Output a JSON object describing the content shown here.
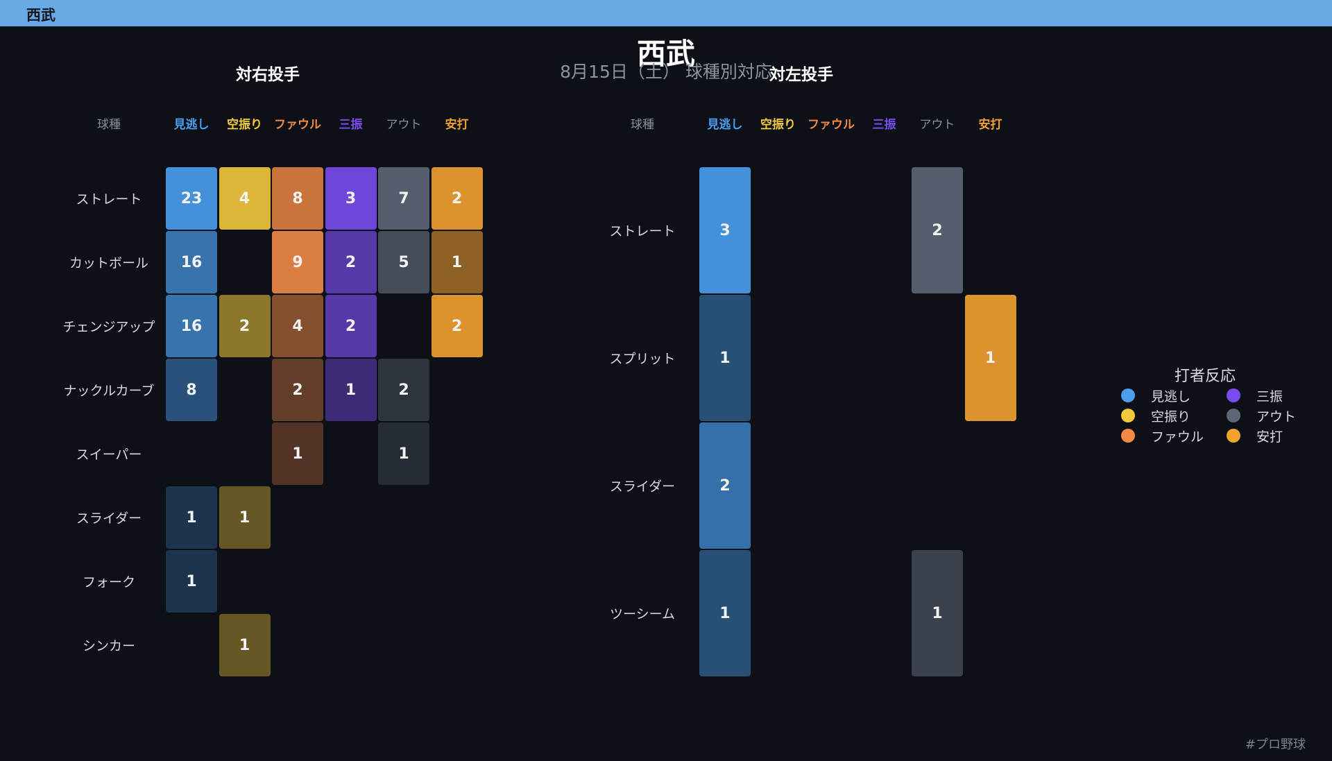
{
  "header": {
    "title": "西武"
  },
  "title": "西武",
  "subtitle": "8月15日（土） 球種別対応",
  "footer": "#プロ野球",
  "colors": {
    "見逃し": "#4a9fef",
    "空振り": "#f2c83c",
    "ファウル": "#f28a46",
    "三振": "#7a4cf0",
    "アウト": "#5d6775",
    "安打": "#f3a12f"
  },
  "chart_data": [
    {
      "type": "heatmap",
      "title": "対右投手",
      "corner_label": "球種",
      "columns": [
        "見逃し",
        "空振り",
        "ファウル",
        "三振",
        "アウト",
        "安打"
      ],
      "rows": [
        "ストレート",
        "カットボール",
        "チェンジアップ",
        "ナックルカーブ",
        "スイーパー",
        "スライダー",
        "フォーク",
        "シンカー"
      ],
      "values": [
        [
          23,
          4,
          8,
          3,
          7,
          2
        ],
        [
          16,
          0,
          9,
          2,
          5,
          1
        ],
        [
          16,
          2,
          4,
          2,
          0,
          2
        ],
        [
          8,
          0,
          2,
          1,
          2,
          0
        ],
        [
          0,
          0,
          1,
          0,
          1,
          0
        ],
        [
          1,
          1,
          0,
          0,
          0,
          0
        ],
        [
          1,
          0,
          0,
          0,
          0,
          0
        ],
        [
          0,
          1,
          0,
          0,
          0,
          0
        ]
      ]
    },
    {
      "type": "heatmap",
      "title": "対左投手",
      "corner_label": "球種",
      "columns": [
        "見逃し",
        "空振り",
        "ファウル",
        "三振",
        "アウト",
        "安打"
      ],
      "rows": [
        "ストレート",
        "スプリット",
        "スライダー",
        "ツーシーム"
      ],
      "values": [
        [
          3,
          0,
          0,
          0,
          2,
          0
        ],
        [
          1,
          0,
          0,
          0,
          0,
          1
        ],
        [
          2,
          0,
          0,
          0,
          0,
          0
        ],
        [
          1,
          0,
          0,
          0,
          1,
          0
        ]
      ]
    }
  ],
  "legend": {
    "title": "打者反応",
    "items": [
      "見逃し",
      "三振",
      "空振り",
      "アウト",
      "ファウル",
      "安打"
    ]
  }
}
